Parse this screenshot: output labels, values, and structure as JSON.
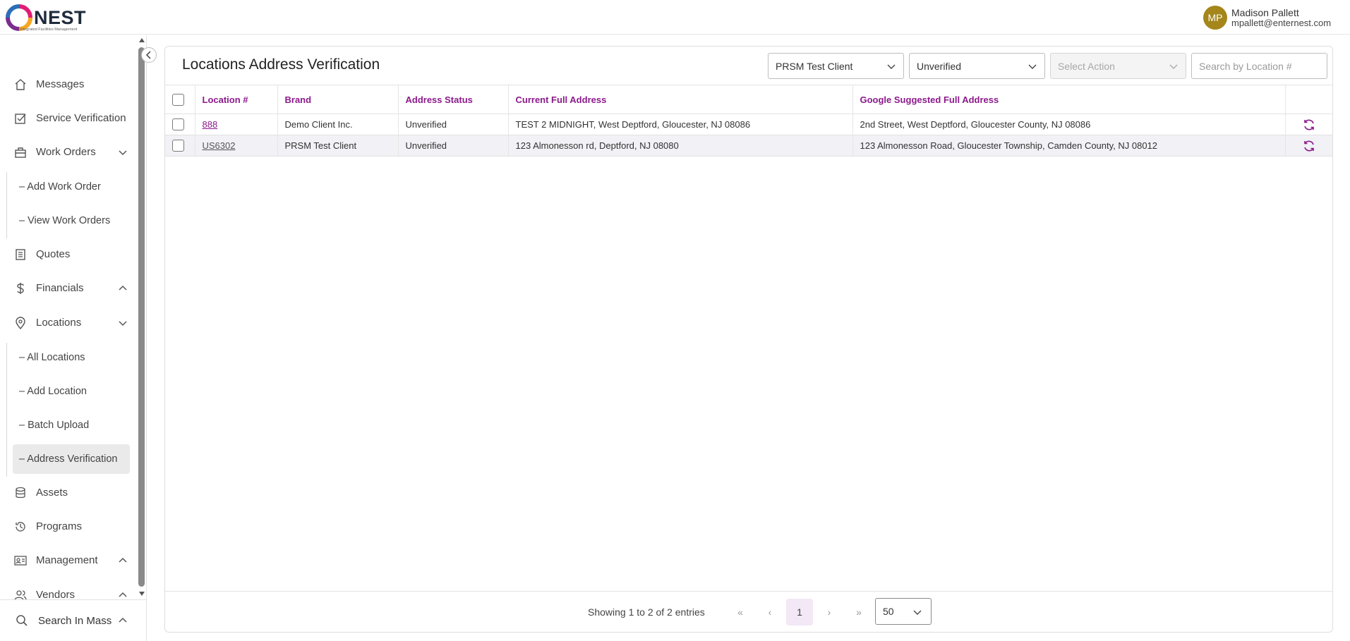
{
  "app": {
    "logo_text": "NEST",
    "logo_tagline": "Integrated Facilities Management"
  },
  "user": {
    "initials": "MP",
    "name": "Madison Pallett",
    "email": "mpallett@enternest.com",
    "avatar_color": "#a4861a"
  },
  "sidebar": {
    "items": {
      "messages": "Messages",
      "service_verification": "Service Verification",
      "work_orders": "Work Orders",
      "add_work_order": "Add Work Order",
      "view_work_orders": "View Work Orders",
      "quotes": "Quotes",
      "financials": "Financials",
      "locations": "Locations",
      "all_locations": "All Locations",
      "add_location": "Add Location",
      "batch_upload": "Batch Upload",
      "address_verification": "Address Verification",
      "assets": "Assets",
      "programs": "Programs",
      "management": "Management",
      "vendors": "Vendors"
    },
    "search_in_mass": "Search In Mass",
    "active_item": "Address Verification"
  },
  "page": {
    "title": "Locations Address Verification"
  },
  "filters": {
    "client_value": "PRSM Test Client",
    "status_value": "Unverified",
    "action_placeholder": "Select Action",
    "search_placeholder": "Search by Location #"
  },
  "table": {
    "columns": {
      "location": "Location #",
      "brand": "Brand",
      "status": "Address Status",
      "current": "Current Full Address",
      "google": "Google Suggested Full Address"
    },
    "rows": [
      {
        "location": "888",
        "brand": "Demo Client Inc.",
        "status": "Unverified",
        "current": "TEST 2 MIDNIGHT, West Deptford, Gloucester, NJ 08086",
        "google": "2nd Street, West Deptford, Gloucester County, NJ 08086"
      },
      {
        "location": "US6302",
        "brand": "PRSM Test Client",
        "status": "Unverified",
        "current": "123 Almonesson rd, Deptford, NJ 08080",
        "google": "123 Almonesson Road, Gloucester Township, Camden County, NJ 08012"
      }
    ]
  },
  "pagination": {
    "summary": "Showing 1 to 2 of 2 entries",
    "first": "«",
    "prev": "‹",
    "current_page": "1",
    "next": "›",
    "last": "»",
    "per_page": "50"
  },
  "colors": {
    "accent": "#8b1a8b",
    "active_page_bg": "#f3e8f6",
    "row_alt_bg": "#f1f1f6"
  },
  "icons": {
    "messages": "home-icon",
    "service_verification": "checkbox-icon",
    "work_orders": "toolbox-icon",
    "quotes": "document-icon",
    "financials": "dollar-icon",
    "locations": "map-pin-icon",
    "assets": "database-icon",
    "programs": "history-icon",
    "management": "id-card-icon",
    "vendors": "users-icon",
    "search": "search-icon",
    "refresh": "refresh-icon"
  }
}
